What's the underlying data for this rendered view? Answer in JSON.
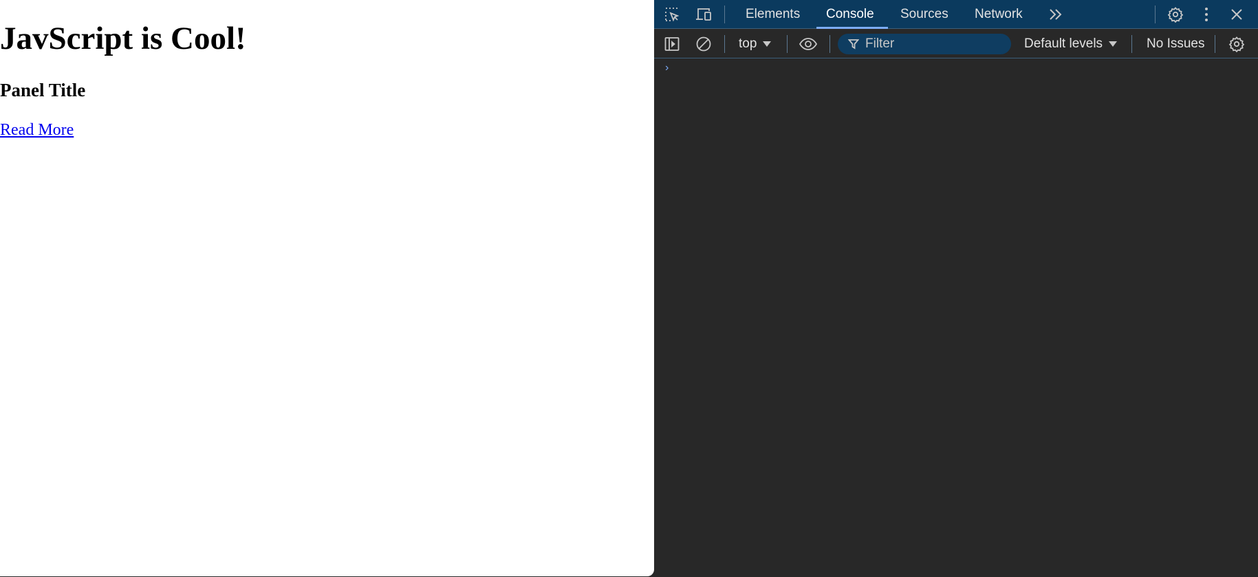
{
  "page": {
    "heading": "JavScript is Cool!",
    "subheading": "Panel Title",
    "link": "Read More"
  },
  "devtools": {
    "tabs": [
      {
        "label": "Elements"
      },
      {
        "label": "Console",
        "active": true
      },
      {
        "label": "Sources"
      },
      {
        "label": "Network"
      }
    ],
    "icons": {
      "inspect": "inspect-element-icon",
      "device": "device-toolbar-icon",
      "more_tabs": "chevron-double-right-icon",
      "settings": "gear-icon",
      "menu": "kebab-menu-icon",
      "close": "close-icon"
    },
    "console_toolbar": {
      "context": "top",
      "filter_placeholder": "Filter",
      "levels": "Default levels",
      "issues": "No Issues"
    },
    "prompt_symbol": "›"
  },
  "colors": {
    "tabbar_bg": "#0b3a5e",
    "panel_bg": "#282828",
    "active_tab_underline": "#7cacf8",
    "link": "#0000ee"
  }
}
